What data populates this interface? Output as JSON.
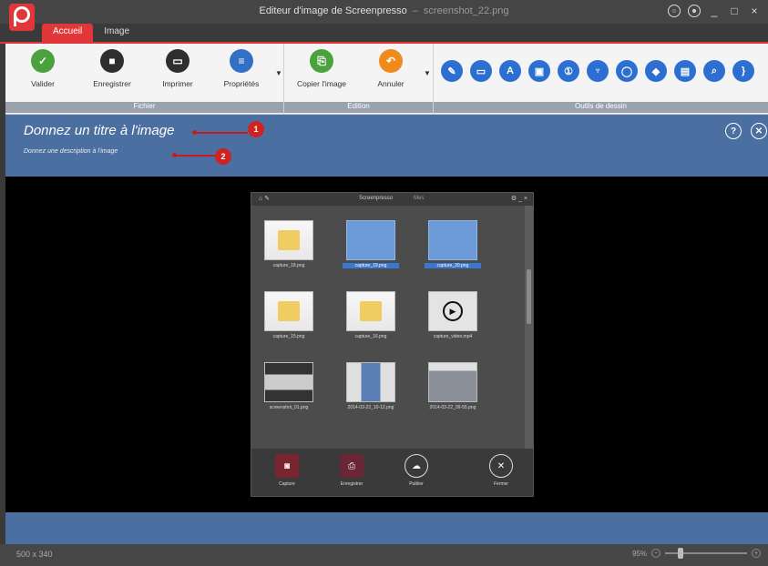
{
  "window": {
    "title": "Editeur d'image de Screenpresso",
    "separator": "–",
    "filename": "screenshot_22.png",
    "controls": [
      "☺",
      "☻",
      "_",
      "□",
      "×"
    ]
  },
  "tabs": [
    {
      "label": "Accueil",
      "active": true
    },
    {
      "label": "Image",
      "active": false
    }
  ],
  "ribbon": {
    "groups": [
      "Fichier",
      "Edition",
      "Outils de dessin"
    ],
    "file_buttons": [
      {
        "label": "Valider",
        "icon": "✓"
      },
      {
        "label": "Enregistrer",
        "icon": "■"
      },
      {
        "label": "Imprimer",
        "icon": "▭"
      },
      {
        "label": "Propriétés",
        "icon": "≡"
      }
    ],
    "edit_buttons": [
      {
        "label": "Copier l'image",
        "icon": "⎘"
      },
      {
        "label": "Annuler",
        "icon": "↶"
      }
    ],
    "tools": [
      "✎",
      "▭",
      "A",
      "▣",
      "①",
      "♆",
      "◯",
      "◆",
      "▤",
      "⌕",
      "}"
    ]
  },
  "info": {
    "title": "Donnez un titre à l'image",
    "description": "Donnez une description à l'image",
    "callouts": [
      "1",
      "2"
    ],
    "help": "?",
    "close": "✕"
  },
  "inner": {
    "title": "Screenpresso",
    "subtitle": "Mes",
    "left_icons": "⌂ ✎",
    "right_icons": "⚙ _ ×",
    "thumbs": [
      {
        "cap": "capture_18.png",
        "kind": "folder",
        "sel": false
      },
      {
        "cap": "capture_19.png",
        "kind": "sel",
        "sel": true
      },
      {
        "cap": "capture_20.png",
        "kind": "sel",
        "sel": true
      },
      {
        "cap": "capture_15.png",
        "kind": "folder",
        "sel": false
      },
      {
        "cap": "capture_16.png",
        "kind": "folder",
        "sel": false
      },
      {
        "cap": "capture_video.mp4",
        "kind": "video",
        "sel": false
      },
      {
        "cap": "screenshot_01.png",
        "kind": "dark",
        "sel": false
      },
      {
        "cap": "2014-03-22_10-12.png",
        "kind": "phone",
        "sel": false
      },
      {
        "cap": "2014-03-22_09-55.png",
        "kind": "win",
        "sel": false
      }
    ],
    "bottom": [
      {
        "label": "Capture",
        "icon": "◙",
        "color": "#7a2430"
      },
      {
        "label": "Enregistrer",
        "icon": "⎙",
        "color": "#6a2634"
      },
      {
        "label": "Publier",
        "icon": "☁",
        "color": "#3a3a3a"
      },
      {
        "label": "Fermer",
        "icon": "✕",
        "color": "#3a3a3a"
      }
    ]
  },
  "status": {
    "dims": "500 x 340",
    "zoom": "95%",
    "minus": "−",
    "plus": "+"
  }
}
